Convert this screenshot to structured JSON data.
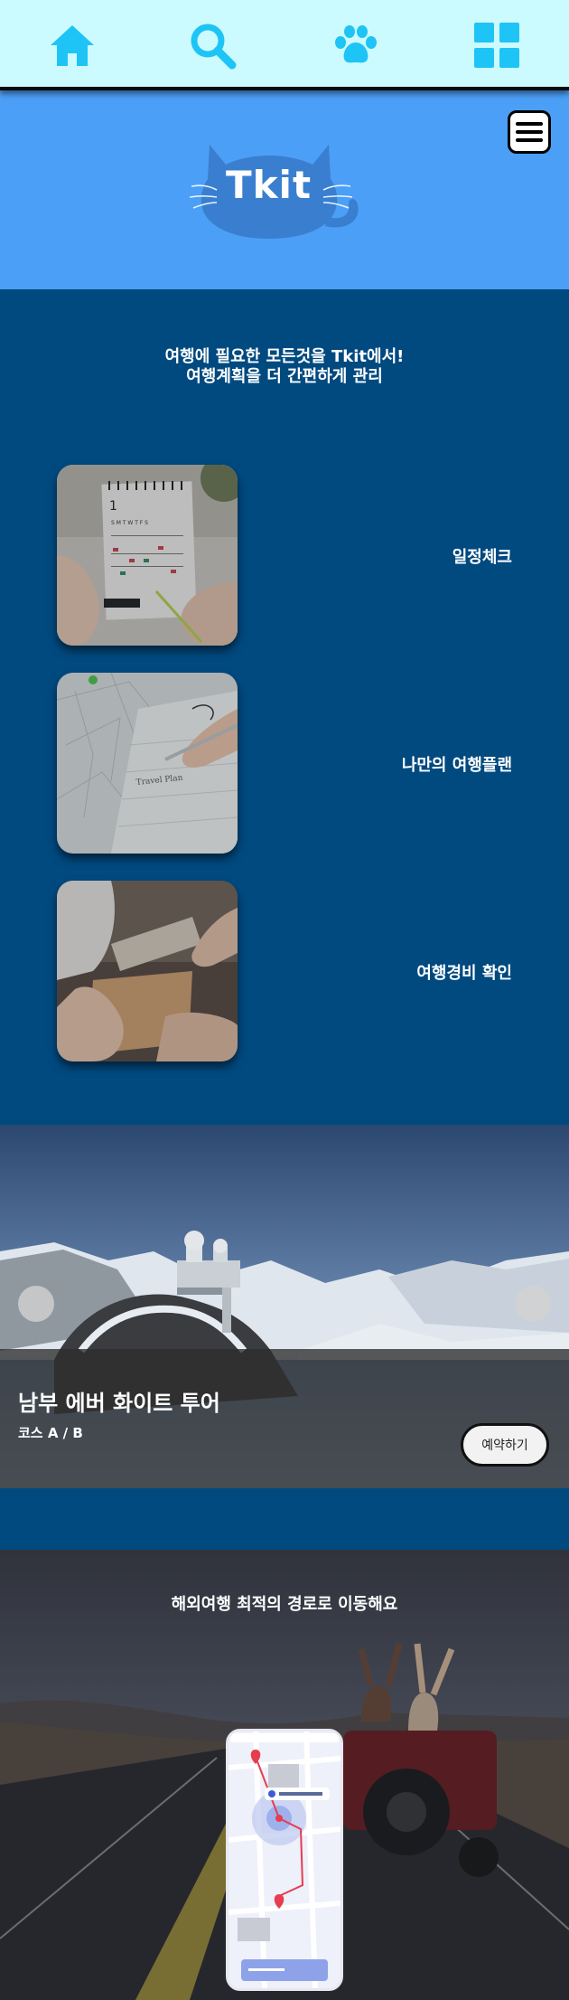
{
  "nav": {
    "items": [
      {
        "name": "home",
        "icon": "home-icon"
      },
      {
        "name": "search",
        "icon": "search-icon"
      },
      {
        "name": "community",
        "icon": "paw-icon"
      },
      {
        "name": "menu",
        "icon": "grid-icon"
      }
    ],
    "icon_color": "#1ec4f5",
    "background": "#ccfbff"
  },
  "header": {
    "logo_text": "Tkit",
    "background": "#4b9ff7",
    "menu_icon": "hamburger-icon"
  },
  "features": {
    "tagline_line1": "여행에 필요한 모든것을 Tkit에서!",
    "tagline_line2": "여행계획을 더 간편하게 관리",
    "items": [
      {
        "label": "일정체크",
        "image": "calendar-photo"
      },
      {
        "label": "나만의 여행플랜",
        "image": "map-planning-photo"
      },
      {
        "label": "여행경비 확인",
        "image": "card-payment-photo"
      }
    ]
  },
  "tour": {
    "title": "남부 에버 화이트 투어",
    "subtitle": "코스 A / B",
    "book_label": "예약하기",
    "image": "snowy-mountain-observatory-photo"
  },
  "route": {
    "title": "해외여행 최적의 경로로 이동해요",
    "image": "road-trip-photo",
    "phone_image": "route-map-app-screen"
  },
  "colors": {
    "dark_blue": "#004a80",
    "light_blue": "#4b9ff7",
    "cyan": "#1ec4f5"
  }
}
